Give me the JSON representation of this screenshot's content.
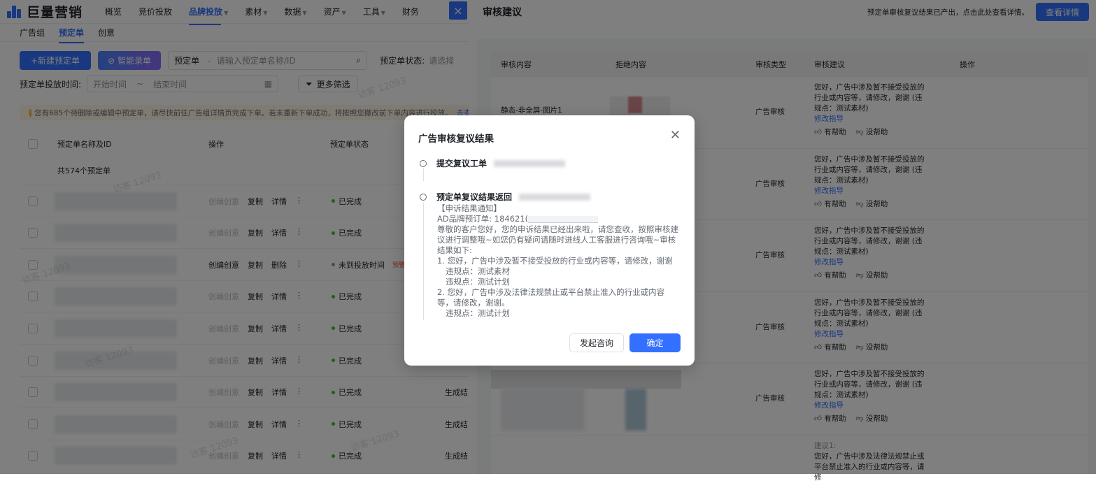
{
  "topnav": {
    "logo": "巨量营销",
    "items": [
      "概览",
      "竞价投放",
      "品牌投放",
      "素材",
      "数据",
      "资产",
      "工具",
      "财务"
    ],
    "active_index": 2,
    "close_icon": "×"
  },
  "subtabs": [
    "广告组",
    "预定单",
    "创意"
  ],
  "toolbar": {
    "new_button": "+新建预定单",
    "smart_button": "智能录单",
    "select_label": "预定单",
    "search_placeholder": "请输入预定单名称/ID",
    "status_label": "预定单状态:",
    "status_placeholder": "请选择",
    "date_label": "预定单投放时间:",
    "date_start": "开始时间",
    "date_end": "结束时间",
    "more_filters": "更多筛选"
  },
  "notice": {
    "text": "您有685个待删除或编辑中预定单，请尽快前往广告组详情页完成下单。若未重新下单成功，将按照您撤改前下单内容进行投放。",
    "link": "去查看"
  },
  "table": {
    "headers": [
      "预定单名称及ID",
      "操作",
      "预定单状态"
    ],
    "total": "共574个预定单",
    "rows": [
      {
        "ops": [
          "创编创意",
          "复制",
          "详情",
          "⋮"
        ],
        "ops_disabled": [
          true,
          false,
          false,
          false
        ],
        "status": "已完成",
        "extra": ""
      },
      {
        "ops": [
          "创编创意",
          "复制",
          "详情",
          "⋮"
        ],
        "ops_disabled": [
          true,
          false,
          false,
          false
        ],
        "status": "已完成",
        "extra": ""
      },
      {
        "ops": [
          "创编创意",
          "复制",
          "删除",
          "⋮"
        ],
        "ops_disabled": [
          false,
          false,
          false,
          false
        ],
        "status": "未到投放时间",
        "extra": "",
        "tag": "预警"
      },
      {
        "ops": [
          "创编创意",
          "复制",
          "详情",
          "⋮"
        ],
        "ops_disabled": [
          true,
          false,
          false,
          false
        ],
        "status": "已完成",
        "extra": ""
      },
      {
        "ops": [
          "创编创意",
          "复制",
          "详情",
          "⋮"
        ],
        "ops_disabled": [
          true,
          false,
          false,
          false
        ],
        "status": "已完成",
        "extra": ""
      },
      {
        "ops": [
          "创编创意",
          "复制",
          "详情",
          "⋮"
        ],
        "ops_disabled": [
          true,
          false,
          false,
          false
        ],
        "status": "已完成",
        "extra": ""
      },
      {
        "ops": [
          "创编创意",
          "复制",
          "详情",
          "⋮"
        ],
        "ops_disabled": [
          true,
          false,
          false,
          false
        ],
        "status": "已完成",
        "extra": "生成结"
      },
      {
        "ops": [
          "创编创意",
          "复制",
          "详情",
          "⋮"
        ],
        "ops_disabled": [
          true,
          false,
          false,
          false
        ],
        "status": "已完成",
        "extra": "生成结"
      },
      {
        "ops": [
          "创编创意",
          "复制",
          "详情",
          "⋮"
        ],
        "ops_disabled": [
          true,
          false,
          false,
          false
        ],
        "status": "已完成",
        "extra": "生成结"
      }
    ]
  },
  "drawer": {
    "title": "审核建议",
    "hint": "预定单审核复议结果已产出，点击此处查看详情。",
    "detail_button": "查看详情",
    "headers": [
      "审核内容",
      "拒绝内容",
      "审核类型",
      "审核建议",
      "操作"
    ],
    "rows": [
      {
        "content": "静态-非全屏-图片1",
        "type": "广告审核",
        "advice": "您好，广告中涉及暂不接受投放的行业或内容等，请修改，谢谢 (违规点：测试素材)",
        "fix": "修改指导",
        "helpful": "有帮助",
        "unhelpful": "没帮助"
      },
      {
        "content": "",
        "type": "广告审核",
        "advice": "您好，广告中涉及暂不接受投放的行业或内容等，请修改，谢谢 (违规点：测试素材)",
        "fix": "修改指导",
        "helpful": "有帮助",
        "unhelpful": "没帮助"
      },
      {
        "content": "",
        "type": "广告审核",
        "advice": "您好，广告中涉及暂不接受投放的行业或内容等，请修改，谢谢 (违规点：测试素材)",
        "fix": "修改指导",
        "helpful": "有帮助",
        "unhelpful": "没帮助"
      },
      {
        "content": "",
        "type": "广告审核",
        "advice": "您好，广告中涉及暂不接受投放的行业或内容等，请修改，谢谢 (违规点：测试素材)",
        "fix": "修改指导",
        "helpful": "有帮助",
        "unhelpful": "没帮助"
      },
      {
        "content": "",
        "type": "广告审核",
        "advice": "您好，广告中涉及暂不接受投放的行业或内容等，请修改，谢谢 (违规点：测试素材)",
        "fix": "修改指导",
        "helpful": "有帮助",
        "unhelpful": "没帮助"
      }
    ],
    "last_row": {
      "label": "建议1:",
      "advice": "您好，广告中涉及法律法规禁止或平台禁止准入的行业或内容等，请修"
    }
  },
  "modal": {
    "title": "广告审核复议结果",
    "step1": "提交复议工单",
    "step2": "预定单复议结果返回",
    "body": {
      "heading": "【申诉结果通知】",
      "order": "AD品牌预订单: 184621(",
      "intro": "尊敬的客户您好，您的申诉结果已经出来啦，请您查收，按照审核建议进行调整哦~如您仍有疑问请随时进线人工客服进行咨询哦~审核结果如下:",
      "item1": "1. 您好，广告中涉及暂不接受投放的行业或内容等，请修改，谢谢",
      "item1_v1": "违规点：测试素材",
      "item1_v2": "违规点：测试计划",
      "item2": "2. 您好，广告中涉及法律法规禁止或平台禁止准入的行业或内容等，请修改，谢谢。",
      "item2_v1": "违规点：测试计划"
    },
    "consult_button": "发起咨询",
    "confirm_button": "确定"
  },
  "watermark": "访客 12093",
  "colors": {
    "accent": "#3370ff",
    "success": "#34c724",
    "warning_bg": "#fff7e6"
  }
}
